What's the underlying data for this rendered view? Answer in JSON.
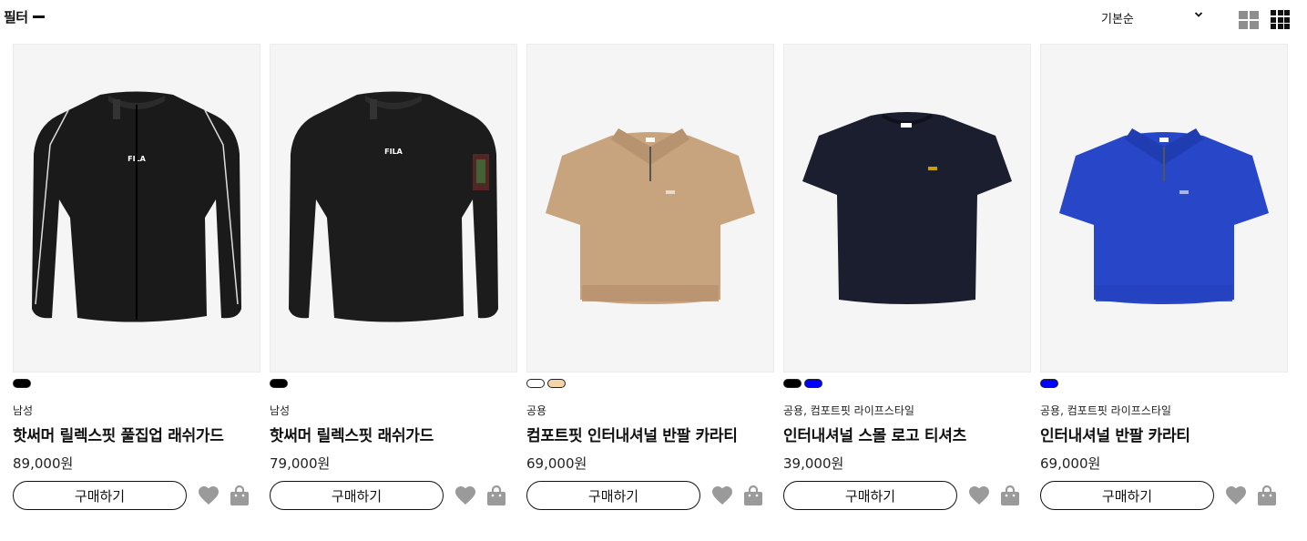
{
  "filter": {
    "label": "필터"
  },
  "sort": {
    "selected": "기본순"
  },
  "view_toggle": {
    "icons": [
      "grid-2-icon",
      "grid-4-icon"
    ]
  },
  "products": [
    {
      "category": "남성",
      "name": "핫써머 릴렉스핏 풀집업 래쉬가드",
      "price": "89,000원",
      "buy_label": "구매하기",
      "swatches": [
        "#000000"
      ],
      "shirt_color": "#1a1a1a",
      "logo_text": "FILA"
    },
    {
      "category": "남성",
      "name": "핫써머 릴렉스핏 래쉬가드",
      "price": "79,000원",
      "buy_label": "구매하기",
      "swatches": [
        "#000000"
      ],
      "shirt_color": "#1c1c1c",
      "logo_text": "FILA"
    },
    {
      "category": "공용",
      "name": "컴포트핏 인터내셔널 반팔 카라티",
      "price": "69,000원",
      "buy_label": "구매하기",
      "swatches": [
        "#ffffff",
        "#f5d3a8"
      ],
      "shirt_color": "#c8a47e"
    },
    {
      "category": "공용, 컴포트핏 라이프스타일",
      "name": "인터내셔널 스몰 로고 티셔츠",
      "price": "39,000원",
      "buy_label": "구매하기",
      "swatches": [
        "#000000",
        "#0000ff"
      ],
      "shirt_color": "#1b1e2e"
    },
    {
      "category": "공용, 컴포트핏 라이프스타일",
      "name": "인터내셔널 반팔 카라티",
      "price": "69,000원",
      "buy_label": "구매하기",
      "swatches": [
        "#0000ff"
      ],
      "shirt_color": "#2846c8"
    }
  ],
  "colors": {
    "icon_gray": "#9a9a9a",
    "border": "#111111",
    "image_bg": "#f5f5f5"
  }
}
